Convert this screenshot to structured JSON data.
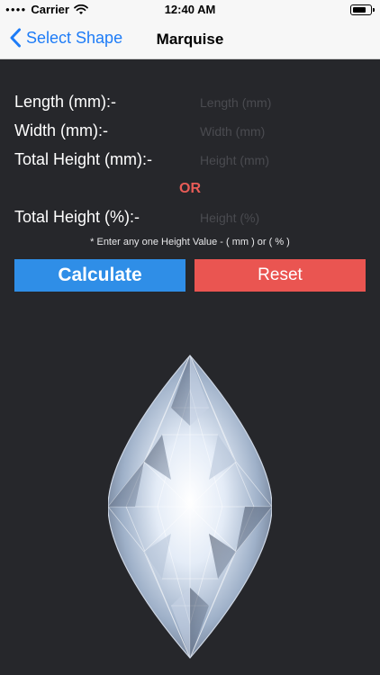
{
  "status": {
    "dots": "●●●●",
    "carrier": "Carrier",
    "time": "12:40 AM",
    "battery_level": 0.7
  },
  "nav": {
    "back_label": "Select Shape",
    "title": "Marquise"
  },
  "form": {
    "length": {
      "label": "Length (mm):-",
      "placeholder": "Length (mm)"
    },
    "width": {
      "label": "Width (mm):-",
      "placeholder": "Width (mm)"
    },
    "total_height_mm": {
      "label": "Total Height (mm):-",
      "placeholder": "Height (mm)"
    },
    "or_text": "OR",
    "total_height_pct": {
      "label": "Total Height (%):-",
      "placeholder": "Height (%)"
    },
    "hint": "* Enter any one Height Value - ( mm ) or ( % )"
  },
  "buttons": {
    "calculate": "Calculate",
    "reset": "Reset"
  },
  "colors": {
    "accent_blue": "#2f8ee7",
    "reset_red": "#ea5551",
    "or_red": "#e85c57",
    "background": "#26272b"
  },
  "image": {
    "icon": "marquise-diamond-icon"
  }
}
